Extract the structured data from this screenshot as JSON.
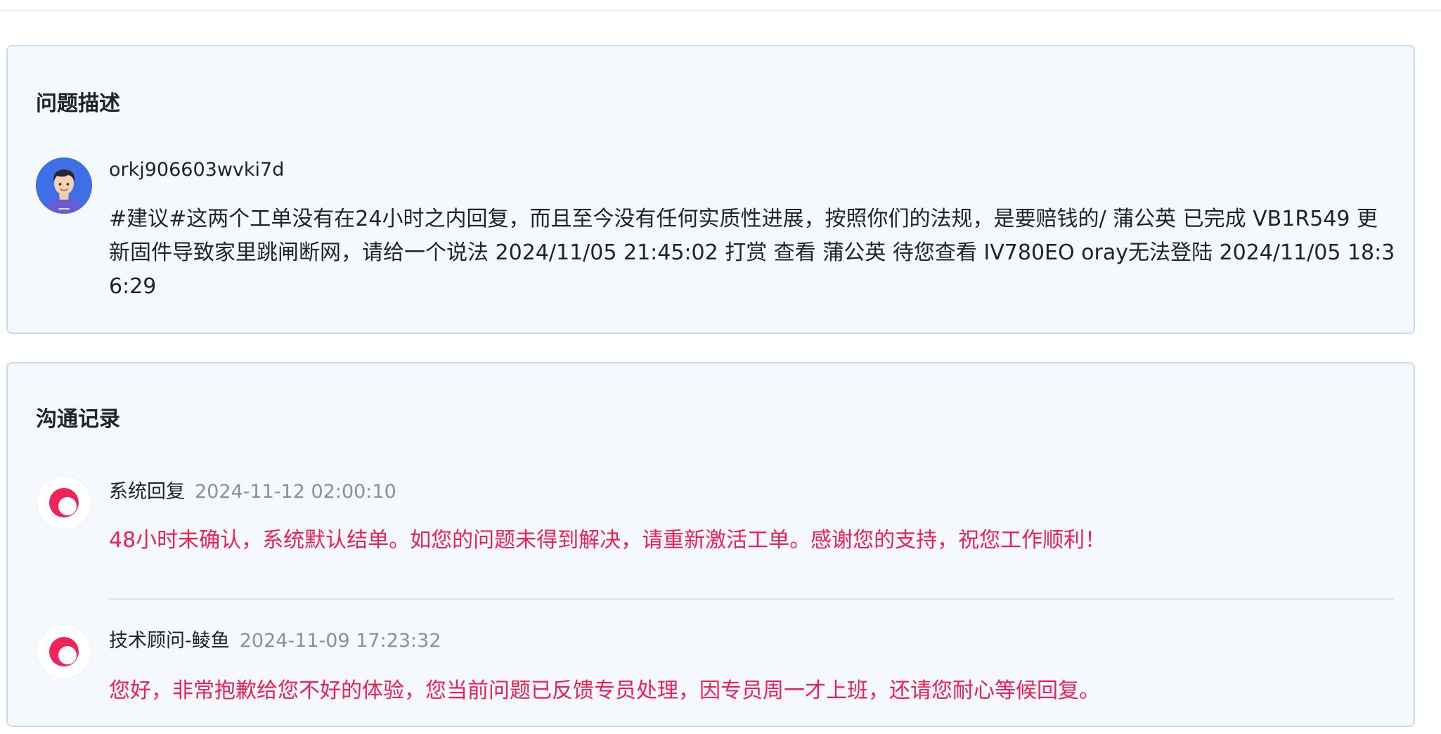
{
  "problem": {
    "title": "问题描述",
    "username": "orkj906603wvki7d",
    "content": "#建议#这两个工单没有在24小时之内回复，而且至今没有任何实质性进展，按照你们的法规，是要赔钱的/ 蒲公英 已完成 VB1R549 更新固件导致家里跳闸断网，请给一个说法 2024/11/05 21:45:02 打赏 查看 蒲公英 待您查看 IV780EO oray无法登陆 2024/11/05 18:36:29"
  },
  "communication": {
    "title": "沟通记录",
    "entries": [
      {
        "author": "系统回复",
        "time": "2024-11-12 02:00:10",
        "message": "48小时未确认，系统默认结单。如您的问题未得到解决，请重新激活工单。感谢您的支持，祝您工作顺利！"
      },
      {
        "author": "技术顾问-鲮鱼",
        "time": "2024-11-09 17:23:32",
        "message": "您好，非常抱歉给您不好的体验，您当前问题已反馈专员处理，因专员周一才上班，还请您耐心等候回复。"
      }
    ]
  },
  "colors": {
    "accent_red": "#ee1f52",
    "card_background": "#f5f8fc",
    "card_border": "#c9ddf0",
    "user_avatar_bg": "#3e6fe6"
  },
  "icons": {
    "user_avatar": "user-avatar-icon",
    "system_avatar": "brand-logo-icon"
  }
}
